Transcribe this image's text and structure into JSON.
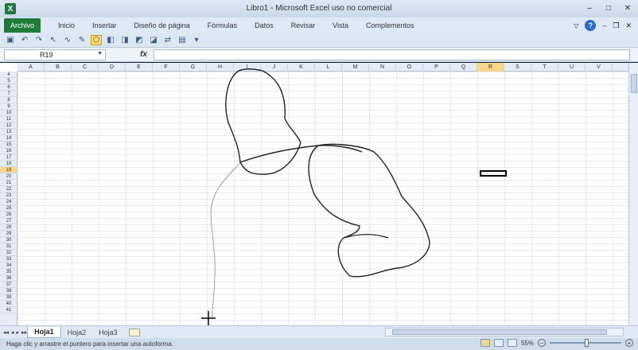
{
  "window": {
    "title": "Libro1 - Microsoft Excel uso no comercial",
    "app_icon_text": "X",
    "controls": [
      "–",
      "□",
      "✕"
    ]
  },
  "ribbon": {
    "file_tab": "Archivo",
    "tabs": [
      "Inicio",
      "Insertar",
      "Diseño de página",
      "Fórmulas",
      "Datos",
      "Revisar",
      "Vista",
      "Complementos"
    ],
    "help_icon": "?"
  },
  "toolbar": {
    "icons": [
      "save-icon",
      "undo-icon",
      "redo-icon",
      "select-icon",
      "curve-icon",
      "pencil-icon",
      "freeform-icon",
      "shape-icon",
      "shape2-icon",
      "shape3-icon",
      "shape4-icon",
      "arrange-icon",
      "customize-icon"
    ]
  },
  "formula_bar": {
    "name_box": "R19",
    "fx_label": "fx",
    "value": ""
  },
  "grid": {
    "columns": [
      "A",
      "B",
      "C",
      "D",
      "E",
      "F",
      "G",
      "H",
      "I",
      "J",
      "K",
      "L",
      "M",
      "N",
      "O",
      "P",
      "Q",
      "R",
      "S",
      "T",
      "U",
      "V"
    ],
    "selected_column": "R",
    "rows": [
      "4",
      "5",
      "6",
      "7",
      "8",
      "9",
      "10",
      "11",
      "12",
      "13",
      "14",
      "15",
      "16",
      "17",
      "18",
      "19",
      "20",
      "21",
      "22",
      "23",
      "24",
      "25",
      "26",
      "27",
      "28",
      "29",
      "30",
      "31",
      "32",
      "33",
      "34",
      "35",
      "36",
      "37",
      "38",
      "39",
      "40",
      "41"
    ],
    "selected_row": "19"
  },
  "sheets": {
    "tabs": [
      "Hoja1",
      "Hoja2",
      "Hoja3"
    ],
    "active": "Hoja1",
    "nav": [
      "◂◂",
      "◂",
      "▸",
      "▸▸"
    ]
  },
  "status": {
    "message": "Haga clic y arrastre el puntero para insertar una autoforma.",
    "zoom": "55%"
  }
}
